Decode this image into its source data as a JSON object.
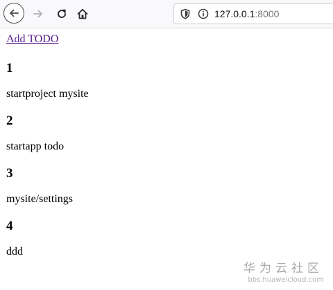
{
  "browser": {
    "url_host": "127.0.0.1",
    "url_port": ":8000",
    "icons": {
      "back": "arrow-left-icon",
      "forward": "arrow-right-icon",
      "reload": "reload-icon",
      "home": "home-icon",
      "shield": "shield-icon",
      "info": "info-icon"
    }
  },
  "page": {
    "add_link": "Add TODO",
    "todos": [
      {
        "id": "1",
        "text": "startproject mysite"
      },
      {
        "id": "2",
        "text": "startapp todo"
      },
      {
        "id": "3",
        "text": "mysite/settings"
      },
      {
        "id": "4",
        "text": "ddd"
      }
    ]
  },
  "watermark": {
    "title": "华为云社区",
    "url": "bbs.huaweicloud.com"
  },
  "colors": {
    "link_visited": "#551a8b",
    "toolbar_bg": "#f9f9fb",
    "watermark": "#a9a9a9"
  }
}
